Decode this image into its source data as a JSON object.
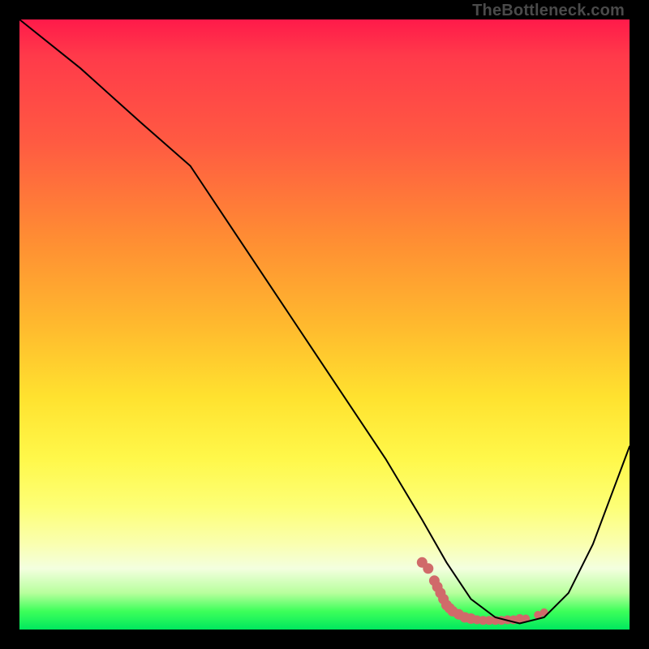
{
  "watermark": "TheBottleneck.com",
  "chart_data": {
    "type": "line",
    "title": "",
    "xlabel": "",
    "ylabel": "",
    "xlim": [
      0,
      100
    ],
    "ylim": [
      0,
      100
    ],
    "grid": false,
    "legend": false,
    "series": [
      {
        "name": "curve",
        "color": "#000000",
        "stroke_width": 2,
        "x": [
          0,
          10,
          20,
          28,
          36,
          44,
          52,
          60,
          66,
          70,
          74,
          78,
          82,
          86,
          90,
          94,
          100
        ],
        "y": [
          100,
          92,
          83,
          76,
          64,
          52,
          40,
          28,
          18,
          11,
          5,
          2,
          1,
          2,
          6,
          14,
          30
        ]
      },
      {
        "name": "valley-dots",
        "color": "#d06a6a",
        "type": "scatter",
        "x": [
          66,
          67,
          68,
          68.5,
          69,
          69.5,
          70,
          70.5,
          71,
          72,
          73,
          74,
          75,
          76,
          77,
          78,
          79,
          80,
          81,
          82,
          83,
          85,
          86
        ],
        "y": [
          11,
          10,
          8,
          7,
          6,
          5,
          4,
          3.5,
          3,
          2.5,
          2,
          1.8,
          1.6,
          1.5,
          1.5,
          1.5,
          1.5,
          1.6,
          1.6,
          1.8,
          1.8,
          2.4,
          2.8
        ]
      }
    ]
  }
}
